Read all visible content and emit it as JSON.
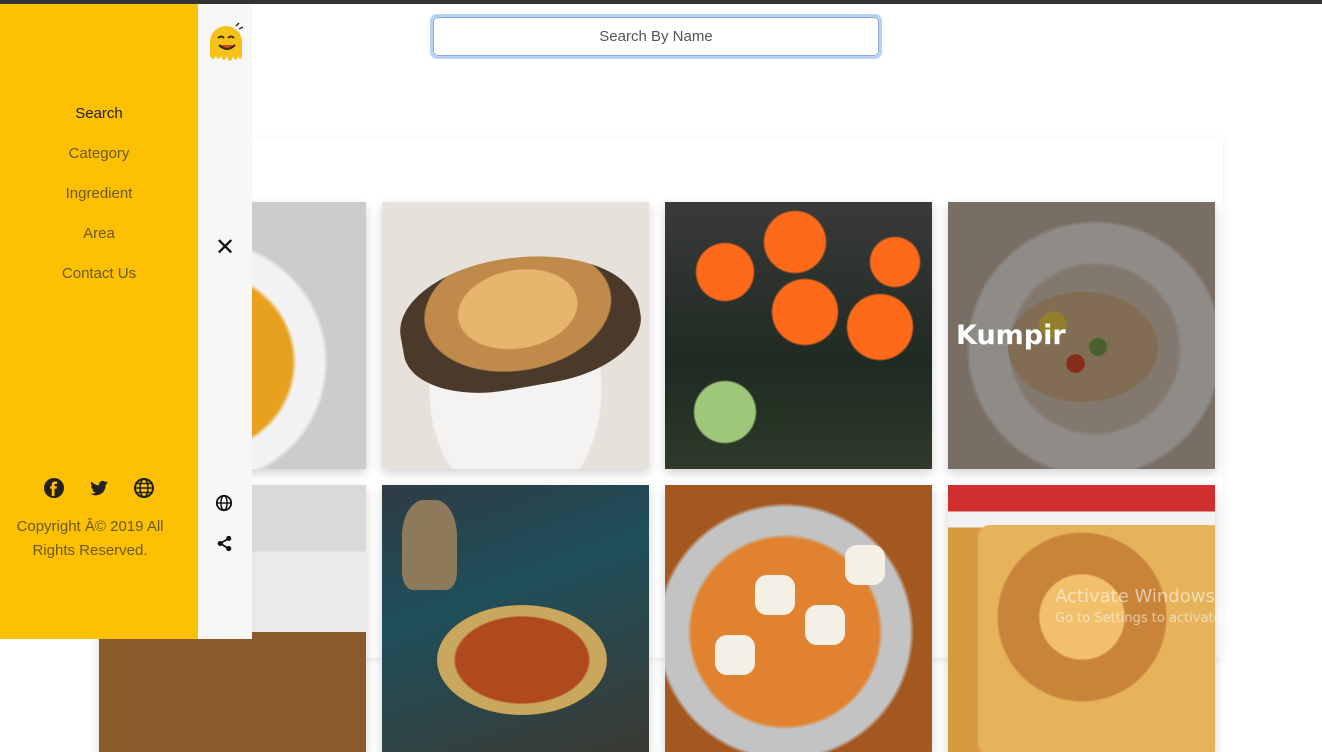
{
  "search": {
    "placeholder": "Search By Name"
  },
  "sidebar": {
    "nav": [
      {
        "label": "Search",
        "active": true
      },
      {
        "label": "Category",
        "active": false
      },
      {
        "label": "Ingredient",
        "active": false
      },
      {
        "label": "Area",
        "active": false
      },
      {
        "label": "Contact Us",
        "active": false
      }
    ],
    "social_icons": [
      "facebook-icon",
      "twitter-icon",
      "globe-icon"
    ],
    "copyright": "Copyright Â© 2019 All Rights Reserved."
  },
  "rail": {
    "logo_icon": "smiley-logo",
    "close_icon": "✕",
    "icons": [
      "globe-icon",
      "share-icon"
    ]
  },
  "meals": [
    {
      "label": "",
      "image": "lentil-soup"
    },
    {
      "label": "",
      "image": "meat-pie"
    },
    {
      "label": "",
      "image": "sushi"
    },
    {
      "label": "Kumpir",
      "image": "kumpir"
    },
    {
      "label": "",
      "image": "falafel"
    },
    {
      "label": "",
      "image": "harira-soup"
    },
    {
      "label": "",
      "image": "poutine"
    },
    {
      "label": "",
      "image": "lasagna"
    }
  ],
  "watermark": {
    "title": "Activate Windows",
    "subtitle": "Go to Settings to activate Windows."
  },
  "colors": {
    "sidebar": "#fec002",
    "rail": "#f7f7f8",
    "focus_ring": "#b8d2f7"
  }
}
